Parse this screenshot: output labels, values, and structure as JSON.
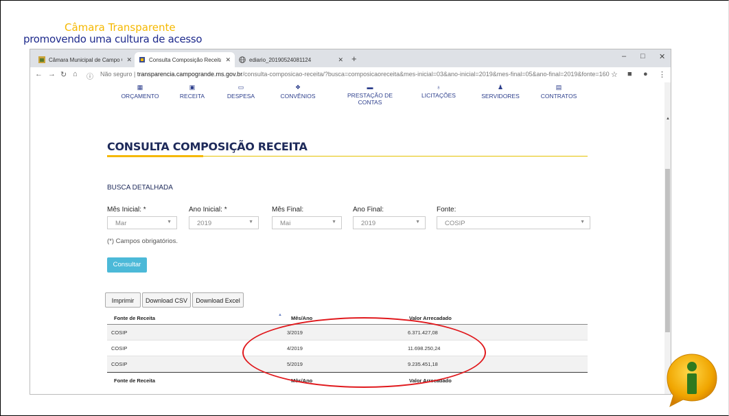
{
  "slide": {
    "title": "Câmara Transparente",
    "subtitle": "promovendo uma cultura de acesso"
  },
  "browser": {
    "tabs": [
      {
        "label": "Câmara Municipal de Campo Gr...",
        "active": false
      },
      {
        "label": "Consulta Composição Receita | T",
        "active": true
      },
      {
        "label": "ediario_20190524081124",
        "active": false
      }
    ],
    "new_tab": "+",
    "window_controls": [
      "–",
      "□",
      "✕"
    ],
    "url_prefix": "Não seguro",
    "url_domain": "transparencia.campogrande.ms.gov.br",
    "url_path": "/consulta-composicao-receita/?busca=composicaoreceita&mes-inicial=03&ano-inicial=2019&mes-final=05&ano-final=2019&fonte=160"
  },
  "nav": {
    "items": [
      {
        "label": "ORÇAMENTO",
        "icon": "calculator-icon"
      },
      {
        "label": "RECEITA",
        "icon": "receipt-icon"
      },
      {
        "label": "DESPESA",
        "icon": "money-icon"
      },
      {
        "label": "CONVÊNIOS",
        "icon": "handshake-icon"
      },
      {
        "label": "PRESTAÇÃO DE CONTAS",
        "icon": "briefcase-icon"
      },
      {
        "label": "LICITAÇÕES",
        "icon": "gavel-icon"
      },
      {
        "label": "SERVIDORES",
        "icon": "users-icon"
      },
      {
        "label": "CONTRATOS",
        "icon": "document-icon"
      }
    ]
  },
  "page": {
    "title": "CONSULTA COMPOSIÇÃO RECEITA",
    "search_heading": "BUSCA DETALHADA",
    "required_note": "(*) Campos obrigatórios.",
    "submit_label": "Consultar"
  },
  "filters": {
    "mes_inicial": {
      "label": "Mês Inicial: *",
      "value": "Mar"
    },
    "ano_inicial": {
      "label": "Ano Inicial: *",
      "value": "2019"
    },
    "mes_final": {
      "label": "Mês Final:",
      "value": "Mai"
    },
    "ano_final": {
      "label": "Ano Final:",
      "value": "2019"
    },
    "fonte": {
      "label": "Fonte:",
      "value": "COSIP"
    }
  },
  "export": {
    "print": "Imprimir",
    "csv": "Download CSV",
    "excel": "Download Excel"
  },
  "table": {
    "columns": [
      "Fonte de Receita",
      "Mês/Ano",
      "Valor Arrecadado"
    ],
    "rows": [
      {
        "fonte": "COSIP",
        "mes_ano": "3/2019",
        "valor": "6.371.427,08"
      },
      {
        "fonte": "COSIP",
        "mes_ano": "4/2019",
        "valor": "11.698.250,24"
      },
      {
        "fonte": "COSIP",
        "mes_ano": "5/2019",
        "valor": "9.235.451,18"
      }
    ]
  },
  "colors": {
    "accent_yellow": "#f5b800",
    "nav_blue": "#2c3e8c",
    "button_cyan": "#4cb9d8",
    "highlight_red": "#e0181c"
  }
}
